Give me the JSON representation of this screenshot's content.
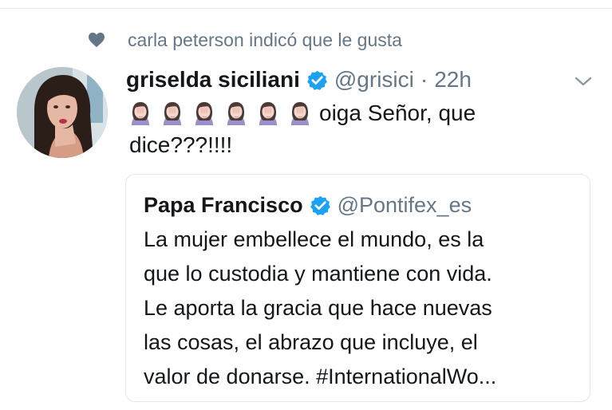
{
  "social_context": {
    "text": "carla peterson indicó que le gusta",
    "icon": "heart-icon"
  },
  "tweet": {
    "display_name": "griselda siciliani",
    "handle": "@grisici",
    "separator": "·",
    "time": "22h",
    "emoji_count": 6,
    "emoji_icon": "woman-facepalming-icon",
    "text": "oiga Señor, que dice???!!!!"
  },
  "quoted": {
    "display_name": "Papa Francisco",
    "handle": "@Pontifex_es",
    "lines": [
      "La mujer embellece el mundo, es la",
      "que lo custodia y mantiene con vida.",
      "Le aporta la gracia que hace nuevas",
      "las cosas, el abrazo que incluye, el",
      "valor de donarse. #InternationalWo..."
    ]
  },
  "colors": {
    "text_primary": "#14171a",
    "text_secondary": "#657786",
    "verified_blue": "#1da1f2",
    "border": "#e1e8ed"
  }
}
